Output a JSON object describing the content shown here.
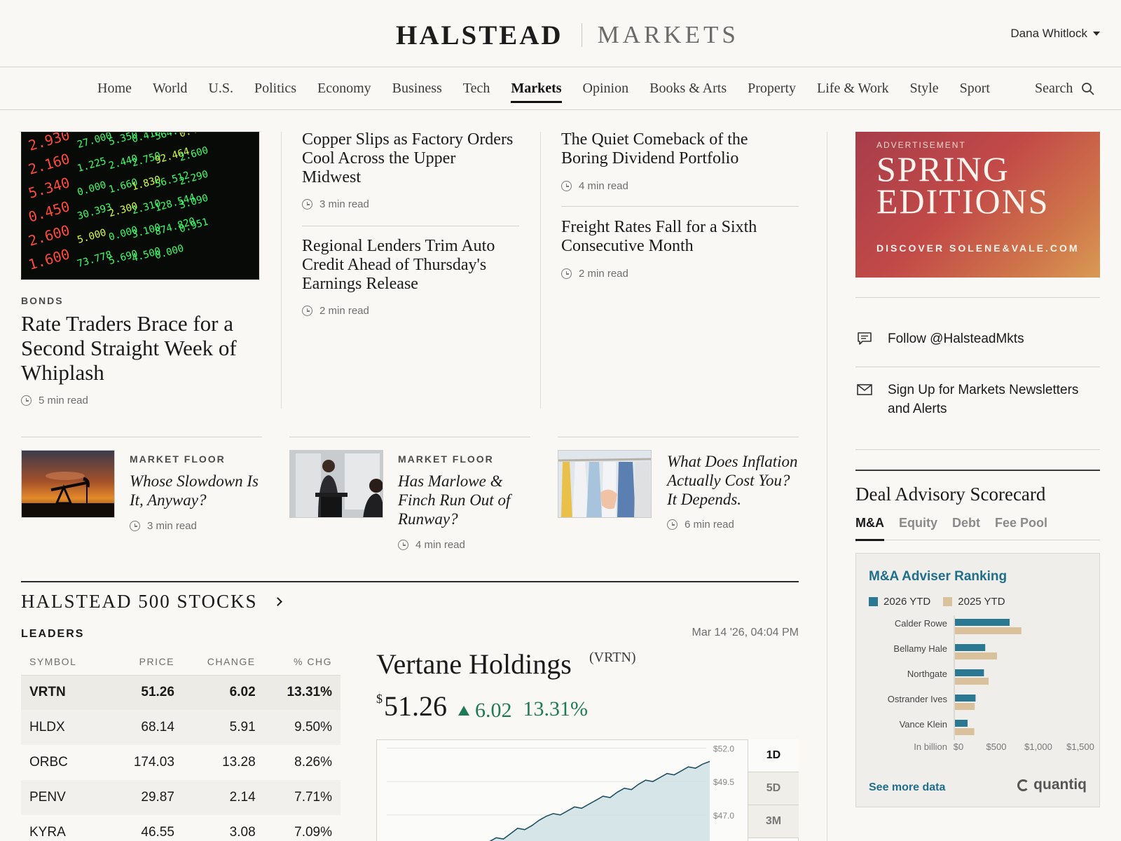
{
  "masthead": {
    "brand_primary": "HALSTEAD",
    "brand_secondary": "MARKETS",
    "user_name": "Dana Whitlock"
  },
  "nav": {
    "items": [
      "Home",
      "World",
      "U.S.",
      "Politics",
      "Economy",
      "Business",
      "Tech",
      "Markets",
      "Opinion",
      "Books & Arts",
      "Property",
      "Life & Work",
      "Style",
      "Sport"
    ],
    "active": "Markets",
    "search_label": "Search"
  },
  "hero": {
    "kicker": "BONDS",
    "title": "Rate Traders Brace for a Second Straight Week of Whiplash",
    "read_time": "5 min read",
    "board_numbers": [
      "2.930",
      "2.160",
      "5.340",
      "0.450",
      "2.600",
      "1.600",
      "27.000",
      "1.225",
      "0.000",
      "30.393",
      "5.000",
      "73.778",
      "5.350",
      "2.440",
      "1.660",
      "2.300",
      "0.000",
      "5.690",
      "0.410",
      "2.750",
      "1.830",
      "2.310",
      "3.100",
      "4.500",
      "564.494",
      "92.464",
      "56.512",
      "128.544",
      "874.820",
      "0.000",
      "0.451",
      "2.600",
      "2.290",
      "3.090",
      "0.951"
    ]
  },
  "stories": {
    "col2": [
      {
        "title": "Copper Slips as Factory Orders Cool Across the Upper Midwest",
        "read_time": "3 min read"
      },
      {
        "title": "Regional Lenders Trim Auto Credit Ahead of Thursday's Earnings Release",
        "read_time": "2 min read"
      }
    ],
    "col3": [
      {
        "title": "The Quiet Comeback of the Boring Dividend Portfolio",
        "read_time": "4 min read"
      },
      {
        "title": "Freight Rates Fall for a Sixth Consecutive Month",
        "read_time": "2 min read"
      }
    ]
  },
  "ad": {
    "label": "ADVERTISEMENT",
    "headline_1": "SPRING",
    "headline_2": "EDITIONS",
    "cta": "DISCOVER SOLENE&VALE.COM"
  },
  "sidebar": {
    "follow": "Follow @HalsteadMkts",
    "newsletter": "Sign Up for Markets Newsletters and Alerts"
  },
  "market_floor": [
    {
      "kicker": "MARKET FLOOR",
      "title": "Whose Slowdown Is It, Anyway?",
      "read_time": "3 min read"
    },
    {
      "kicker": "MARKET FLOOR",
      "title": "Has Marlowe & Finch Run Out of Runway?",
      "read_time": "4 min read"
    },
    {
      "kicker": "",
      "title": "What Does Inflation Actually Cost You? It Depends.",
      "read_time": "6 min read"
    }
  ],
  "stocks": {
    "heading": "HALSTEAD 500 STOCKS",
    "subheading": "LEADERS",
    "timestamp": "Mar 14 '26, 04:04 PM",
    "columns": [
      "SYMBOL",
      "PRICE",
      "CHANGE",
      "% CHG"
    ],
    "rows": [
      {
        "symbol": "VRTN",
        "price": "51.26",
        "change": "6.02",
        "pct": "13.31%"
      },
      {
        "symbol": "HLDX",
        "price": "68.14",
        "change": "5.91",
        "pct": "9.50%"
      },
      {
        "symbol": "ORBC",
        "price": "174.03",
        "change": "13.28",
        "pct": "8.26%"
      },
      {
        "symbol": "PENV",
        "price": "29.87",
        "change": "2.14",
        "pct": "7.71%"
      },
      {
        "symbol": "KYRA",
        "price": "46.55",
        "change": "3.08",
        "pct": "7.09%"
      }
    ]
  },
  "quote": {
    "name": "Vertane Holdings",
    "symbol": "(VRTN)",
    "currency": "$",
    "price": "51.26",
    "change": "6.02",
    "pct": "13.31%",
    "ranges": [
      "1D",
      "5D",
      "3M"
    ],
    "active_range": "1D",
    "axis_labels": [
      "$52.0",
      "$49.5",
      "$47.0"
    ]
  },
  "scorecard": {
    "title": "Deal Advisory Scorecard",
    "tabs": [
      "M&A",
      "Equity",
      "Debt",
      "Fee Pool"
    ],
    "active_tab": "M&A",
    "box_title": "M&A Adviser Ranking",
    "see_more": "See more data",
    "provider": "quantiq"
  },
  "chart_data": [
    {
      "type": "bar",
      "title": "M&A Adviser Ranking",
      "categories": [
        "Calder Rowe",
        "Bellamy Hale",
        "Northgate",
        "Ostrander Ives",
        "Vance Klein"
      ],
      "series": [
        {
          "name": "2026 YTD",
          "values": [
            650,
            360,
            345,
            245,
            150
          ],
          "color": "#2b7893"
        },
        {
          "name": "2025 YTD",
          "values": [
            790,
            500,
            400,
            235,
            230
          ],
          "color": "#d9c19c"
        }
      ],
      "xlabel": "In billion",
      "x_ticks": [
        "$0",
        "$500",
        "$1,000",
        "$1,500"
      ],
      "xlim": [
        0,
        1500
      ],
      "orientation": "horizontal"
    },
    {
      "type": "area",
      "title": "",
      "y_ticks": [
        "$52.0",
        "$49.5",
        "$47.0"
      ],
      "ylim": [
        45.0,
        52.6
      ],
      "y": [
        44.6,
        45.0,
        45.3,
        45.2,
        45.6,
        46.0,
        45.9,
        46.2,
        46.6,
        46.9,
        47.1,
        47.0,
        47.3,
        47.6,
        47.5,
        47.8,
        48.1,
        48.4,
        48.3,
        48.7,
        49.0,
        48.9,
        49.3,
        49.6,
        49.5,
        49.8,
        50.1,
        50.0,
        50.3,
        50.6,
        50.5,
        50.8,
        51.0
      ]
    }
  ]
}
